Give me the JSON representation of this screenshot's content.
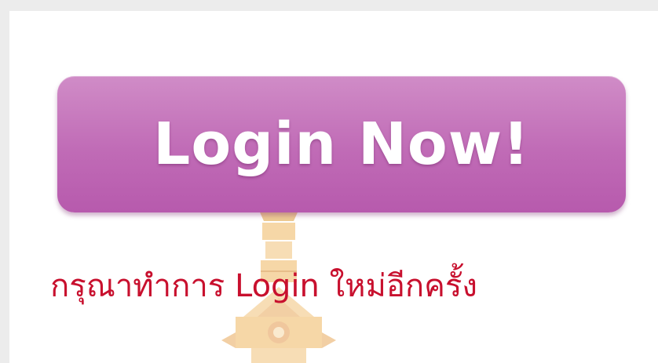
{
  "login_button": {
    "label": "Login Now!"
  },
  "notice": {
    "text": "กรุณาทำการ Login ใหม่อีกครั้ง"
  },
  "watermark": {
    "icon": "temple-spire-emblem-icon"
  },
  "colors": {
    "button_top": "#d08cc7",
    "button_bottom": "#b75aad",
    "button_text": "#ffffff",
    "notice_text": "#c8102e",
    "background": "#ffffff"
  }
}
